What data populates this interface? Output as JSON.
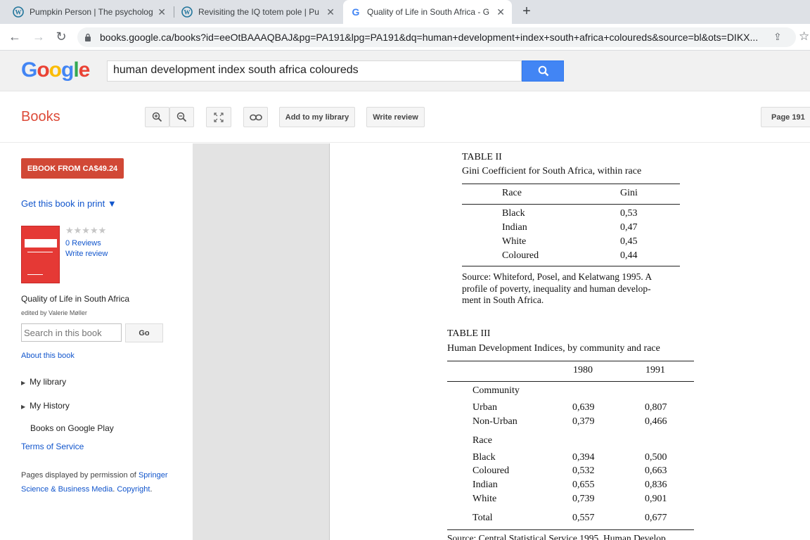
{
  "browser": {
    "tabs": [
      {
        "title": "Pumpkin Person | The psycholog",
        "close": "✕"
      },
      {
        "title": "Revisiting the IQ totem pole | Pu",
        "close": "✕"
      },
      {
        "title": "Quality of Life in South Africa - G",
        "close": "✕"
      }
    ],
    "new_tab": "+",
    "back": "←",
    "forward": "→",
    "reload": "↻",
    "url": "books.google.ca/books?id=eeOtBAAAQBAJ&pg=PA191&lpg=PA191&dq=human+development+index+south+africa+coloureds&source=bl&ots=DIKX...",
    "share": "⇪",
    "star": "☆"
  },
  "google": {
    "logo": [
      "G",
      "o",
      "o",
      "g",
      "l",
      "e"
    ],
    "query": "human development index south africa coloureds"
  },
  "toolbar": {
    "section": "Books",
    "add_library": "Add to my library",
    "write_review": "Write review",
    "page": "Page 191"
  },
  "sidebar": {
    "ebook": "EBOOK FROM CA$49.24",
    "print": "Get this book in print ▼",
    "stars": "★★★★★",
    "reviews": "0 Reviews",
    "write_review": "Write review",
    "book_title": "Quality of Life in South Africa",
    "editor": "edited by Valerie Møller",
    "search_placeholder": "Search in this book",
    "go": "Go",
    "about": "About this book",
    "my_library": "My library",
    "my_history": "My History",
    "google_play": "Books on Google Play",
    "terms": "Terms of Service",
    "perm_prefix": "Pages displayed by permission of ",
    "perm_publisher": "Springer Science & Business Media",
    "perm_copyright": "Copyright"
  },
  "page": {
    "table2": {
      "label": "TABLE II",
      "caption": "Gini Coefficient for South Africa, within race",
      "col_race": "Race",
      "col_gini": "Gini",
      "rows": [
        {
          "race": "Black",
          "gini": "0,53"
        },
        {
          "race": "Indian",
          "gini": "0,47"
        },
        {
          "race": "White",
          "gini": "0,45"
        },
        {
          "race": "Coloured",
          "gini": "0,44"
        }
      ],
      "source_lines": [
        "Source: Whiteford, Posel, and Kelatwang 1995. A",
        "profile of poverty, inequality and human develop-",
        "ment in South Africa."
      ]
    },
    "table3": {
      "label": "TABLE III",
      "caption": "Human Development Indices, by community and race",
      "col_1980": "1980",
      "col_1991": "1991",
      "group_community": "Community",
      "community_rows": [
        {
          "name": "Urban",
          "v1980": "0,639",
          "v1991": "0,807"
        },
        {
          "name": "Non-Urban",
          "v1980": "0,379",
          "v1991": "0,466"
        }
      ],
      "group_race": "Race",
      "race_rows": [
        {
          "name": "Black",
          "v1980": "0,394",
          "v1991": "0,500"
        },
        {
          "name": "Coloured",
          "v1980": "0,532",
          "v1991": "0,663"
        },
        {
          "name": "Indian",
          "v1980": "0,655",
          "v1991": "0,836"
        },
        {
          "name": "White",
          "v1980": "0,739",
          "v1991": "0,901"
        }
      ],
      "total": {
        "name": "Total",
        "v1980": "0,557",
        "v1991": "0,677"
      },
      "source_partial": "Source: Central Statistical Service 1995. Human Develop"
    }
  }
}
